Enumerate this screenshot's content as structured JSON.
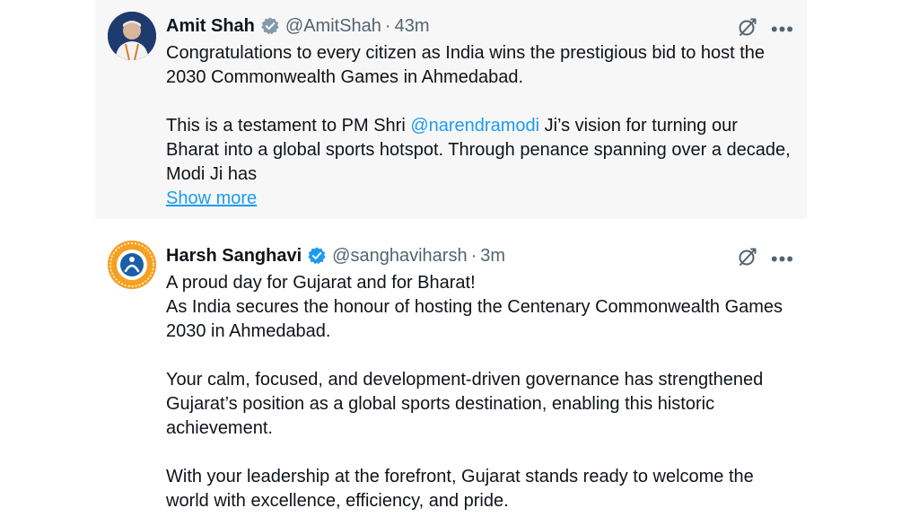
{
  "tweets": [
    {
      "name": "Amit Shah",
      "handle": "@AmitShah",
      "separator": "·",
      "time": "43m",
      "para1": "Congratulations to every citizen as India wins the prestigious bid to host the 2030 Commonwealth Games in Ahmedabad.",
      "para2_before": "This is a testament to PM Shri ",
      "mention": "@narendramodi",
      "para2_after": " Ji’s vision for turning our Bharat into a global sports hotspot. Through penance spanning over a decade, Modi Ji has",
      "show_more": "Show more"
    },
    {
      "name": "Harsh Sanghavi",
      "handle": "@sanghaviharsh",
      "separator": "·",
      "time": "3m",
      "line1": "A proud day for Gujarat and for Bharat!",
      "line2": "As India secures the honour of hosting the Centenary Commonwealth Games 2030 in Ahmedabad.",
      "para2": "Your calm, focused, and development-driven governance has strengthened Gujarat’s position as a global sports destination, enabling this historic achievement.",
      "para3": "With your leadership at the forefront, Gujarat stands ready to welcome the world with excellence, efficiency, and pride."
    }
  ],
  "more_glyph": "•••",
  "icons": {
    "verified": "verified-badge-icon",
    "grok": "grok-icon",
    "more": "more-options-icon"
  },
  "colors": {
    "link": "#1d9bf0",
    "verified": "#1d9bf0",
    "muted": "#536471",
    "tweet1_background": "#f7f7f7"
  }
}
